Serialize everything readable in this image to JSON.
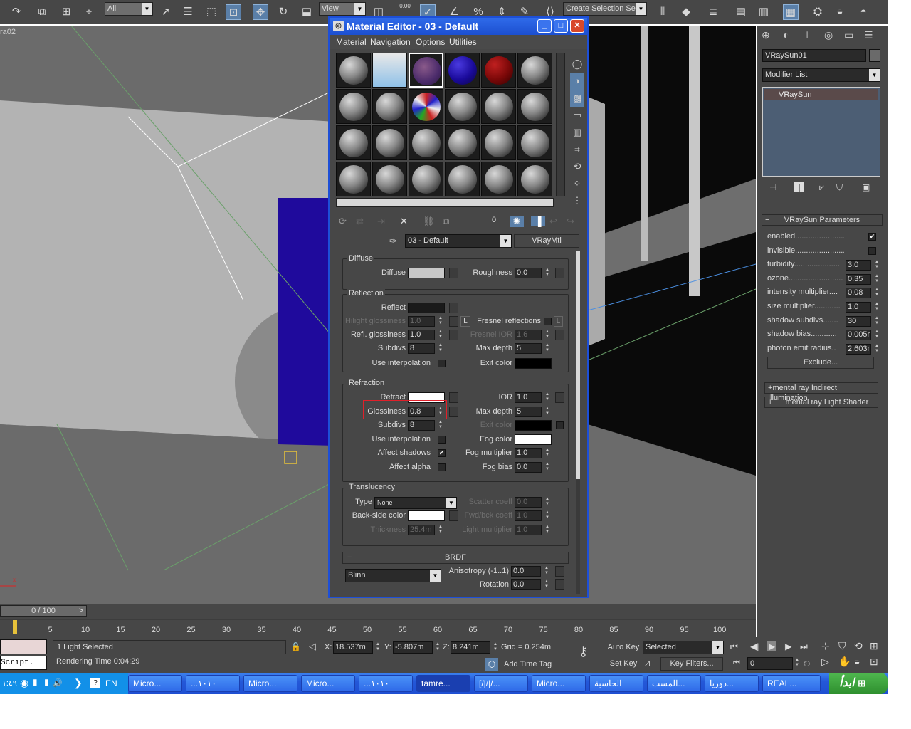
{
  "toolbar": {
    "selection_filter": "All",
    "ref_coord": "View",
    "spinner_value": "0.00",
    "named_selection": "Create Selection Se"
  },
  "viewport": {
    "label": "ra02",
    "axis_x": "x"
  },
  "material_editor": {
    "title": "Material Editor - 03 - Default",
    "menu": [
      "Material",
      "Navigation",
      "Options",
      "Utilities"
    ],
    "material_name": "03 - Default",
    "material_type": "VRayMtl",
    "toolbar_value": "0",
    "diffuse": {
      "section": "Diffuse",
      "diffuse_label": "Diffuse",
      "roughness_label": "Roughness",
      "roughness_value": "0.0"
    },
    "reflection": {
      "section": "Reflection",
      "reflect_label": "Reflect",
      "hilight_label": "Hilight glossiness",
      "hilight_value": "1.0",
      "l_button": "L",
      "fresnel_label": "Fresnel reflections",
      "fresnel_l": "L",
      "refl_gloss_label": "Refl. glossiness",
      "refl_gloss_value": "1.0",
      "fresnel_ior_label": "Fresnel IOR",
      "fresnel_ior_value": "1.6",
      "subdivs_label": "Subdivs",
      "subdivs_value": "8",
      "max_depth_label": "Max depth",
      "max_depth_value": "5",
      "use_interp_label": "Use interpolation",
      "exit_color_label": "Exit color"
    },
    "refraction": {
      "section": "Refraction",
      "refract_label": "Refract",
      "ior_label": "IOR",
      "ior_value": "1.0",
      "glossiness_label": "Glossiness",
      "glossiness_value": "0.8",
      "max_depth_label": "Max depth",
      "max_depth_value": "5",
      "subdivs_label": "Subdivs",
      "subdivs_value": "8",
      "exit_color_label": "Exit color",
      "use_interp_label": "Use interpolation",
      "fog_color_label": "Fog color",
      "affect_shadows_label": "Affect shadows",
      "fog_mult_label": "Fog multiplier",
      "fog_mult_value": "1.0",
      "affect_alpha_label": "Affect alpha",
      "fog_bias_label": "Fog bias",
      "fog_bias_value": "0.0"
    },
    "translucency": {
      "section": "Translucency",
      "type_label": "Type",
      "type_value": "None",
      "scatter_label": "Scatter coeff",
      "scatter_value": "0.0",
      "backside_label": "Back-side color",
      "fwd_label": "Fwd/bck coeff",
      "fwd_value": "1.0",
      "thickness_label": "Thickness",
      "thickness_value": "25.4m",
      "light_mult_label": "Light multiplier",
      "light_mult_value": "1.0"
    },
    "brdf": {
      "section": "BRDF",
      "collapse": "−",
      "type_value": "Blinn",
      "aniso_label": "Anisotropy (-1..1)",
      "aniso_value": "0.0",
      "rotation_label": "Rotation",
      "rotation_value": "0.0"
    }
  },
  "command_panel": {
    "object_name": "VRaySun01",
    "modifier_list": "Modifier List",
    "stack_item": "VRaySun",
    "rollout_title": "VRaySun Parameters",
    "collapse": "−",
    "params": [
      {
        "label": "enabled...........................",
        "type": "check",
        "checked": true
      },
      {
        "label": "invisible.........................",
        "type": "check",
        "checked": false
      },
      {
        "label": "turbidity.....................",
        "value": "3.0"
      },
      {
        "label": "ozone.........................",
        "value": "0.35"
      },
      {
        "label": "intensity multiplier....",
        "value": "0.08"
      },
      {
        "label": "size multiplier............",
        "value": "1.0"
      },
      {
        "label": "shadow subdivs.......",
        "value": "30"
      },
      {
        "label": "shadow bias............",
        "value": "0.005m"
      },
      {
        "label": "photon emit radius..",
        "value": "2.603m"
      }
    ],
    "exclude": "Exclude...",
    "rollout2": "mental ray Indirect Illumination",
    "rollout3": "mental ray Light Shader",
    "plus": "+"
  },
  "timeline": {
    "frame_counter": "0 / 100",
    "ticks": [
      "5",
      "10",
      "15",
      "20",
      "25",
      "30",
      "35",
      "40",
      "45",
      "50",
      "55",
      "60",
      "65",
      "70",
      "75",
      "80",
      "85",
      "90",
      "95",
      "100"
    ]
  },
  "status": {
    "selection": "1 Light Selected",
    "render_time": "Rendering Time  0:04:29",
    "script": "Script.",
    "x_label": "X:",
    "x_value": "18.537m",
    "y_label": "Y:",
    "y_value": "-5.807m",
    "z_label": "Z:",
    "z_value": "8.241m",
    "grid": "Grid = 0.254m",
    "add_time_tag": "Add Time Tag",
    "auto_key": "Auto Key",
    "selected": "Selected",
    "set_key": "Set Key",
    "key_filters": "Key Filters...",
    "frame": "0"
  },
  "taskbar": {
    "start": "ابدأ",
    "tasks": [
      "REAL...",
      "دوريا...",
      "المست...",
      "الحاسبة",
      "Micro...",
      "[/|/|/...",
      "tamre...",
      "...١٠١٠",
      "Micro...",
      "Micro...",
      "...١٠١٠",
      "Micro..."
    ],
    "lang": "EN",
    "clock": "١:٤٩"
  },
  "colors": {
    "ui_gray": "#474747",
    "title_blue": "#1c4fd0",
    "selection_red": "#e0202a",
    "box_blue": "#1f0a9c"
  }
}
